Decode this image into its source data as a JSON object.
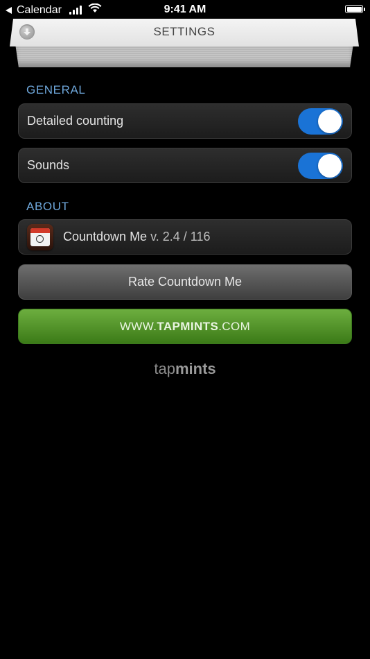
{
  "status_bar": {
    "back_app": "Calendar",
    "time": "9:41 AM"
  },
  "header": {
    "title": "SETTINGS"
  },
  "general": {
    "section_title": "GENERAL",
    "detailed_counting": {
      "label": "Detailed counting",
      "on": true
    },
    "sounds": {
      "label": "Sounds",
      "on": true
    }
  },
  "about": {
    "section_title": "ABOUT",
    "app_name": "Countdown Me",
    "version": "v. 2.4 / 116"
  },
  "actions": {
    "rate_label": "Rate Countdown Me",
    "site_prefix": "WWW.",
    "site_bold": "TAPMINTS",
    "site_suffix": ".COM"
  },
  "brand": {
    "light": "tap",
    "bold": "mints"
  },
  "colors": {
    "accent_blue": "#1a73d6",
    "section_blue": "#6fa8dc",
    "site_green": "#4f8f27"
  }
}
